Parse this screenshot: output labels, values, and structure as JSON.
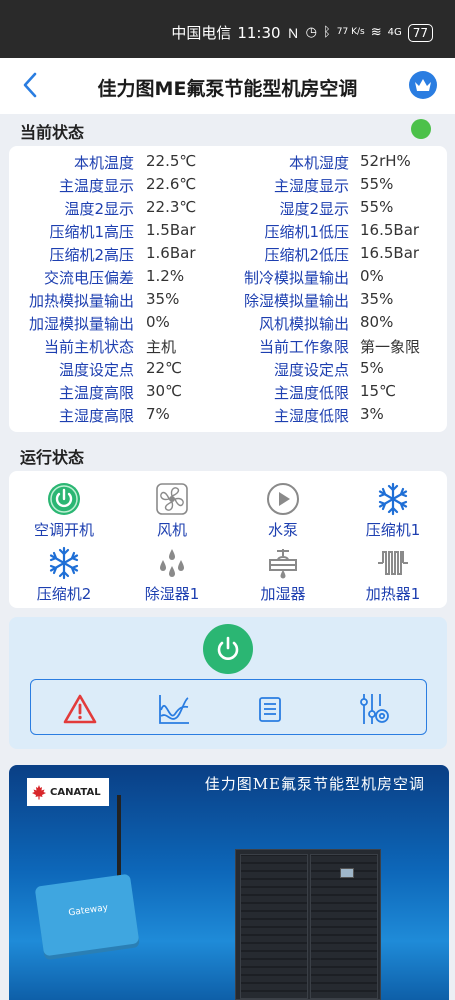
{
  "status_bar": {
    "carrier": "中国电信",
    "time": "11:30",
    "net_speed": "77 K/s",
    "signal": "4G",
    "battery": "77"
  },
  "header": {
    "title": "佳力图ME氟泵节能型机房空调"
  },
  "current_status": {
    "section_title": "当前状态",
    "indicator_color": "#4cc14a",
    "rows": [
      {
        "l1": "本机温度",
        "v1": "22.5℃",
        "l2": "本机湿度",
        "v2": "52rH%"
      },
      {
        "l1": "主温度显示",
        "v1": "22.6℃",
        "l2": "主湿度显示",
        "v2": "55%"
      },
      {
        "l1": "温度2显示",
        "v1": "22.3℃",
        "l2": "湿度2显示",
        "v2": "55%"
      },
      {
        "l1": "压缩机1高压",
        "v1": "1.5Bar",
        "l2": "压缩机1低压",
        "v2": "16.5Bar"
      },
      {
        "l1": "压缩机2高压",
        "v1": "1.6Bar",
        "l2": "压缩机2低压",
        "v2": "16.5Bar"
      },
      {
        "l1": "交流电压偏差",
        "v1": "1.2%",
        "l2": "制冷模拟量输出",
        "v2": "0%"
      },
      {
        "l1": "加热模拟量输出",
        "v1": "35%",
        "l2": "除湿模拟量输出",
        "v2": "35%"
      },
      {
        "l1": "加湿模拟量输出",
        "v1": "0%",
        "l2": "风机模拟输出",
        "v2": "80%"
      },
      {
        "l1": "当前主机状态",
        "v1": "主机",
        "l2": "当前工作象限",
        "v2": "第一象限"
      },
      {
        "l1": "温度设定点",
        "v1": "22℃",
        "l2": "湿度设定点",
        "v2": "5%"
      },
      {
        "l1": "主温度高限",
        "v1": "30℃",
        "l2": "主温度低限",
        "v2": "15℃"
      },
      {
        "l1": "主湿度高限",
        "v1": "7%",
        "l2": "主湿度低限",
        "v2": "3%"
      }
    ]
  },
  "run_status": {
    "section_title": "运行状态",
    "items": [
      {
        "label": "空调开机",
        "icon": "power-on-icon"
      },
      {
        "label": "风机",
        "icon": "fan-icon"
      },
      {
        "label": "水泵",
        "icon": "pump-icon"
      },
      {
        "label": "压缩机1",
        "icon": "snowflake-icon"
      },
      {
        "label": "压缩机2",
        "icon": "snowflake-icon"
      },
      {
        "label": "除湿器1",
        "icon": "droplets-icon"
      },
      {
        "label": "加湿器",
        "icon": "humidifier-icon"
      },
      {
        "label": "加热器1",
        "icon": "heater-icon"
      }
    ]
  },
  "controls": {
    "power_color": "#2bb673",
    "buttons": [
      "alarm-icon",
      "chart-icon",
      "list-icon",
      "settings-sliders-icon"
    ]
  },
  "banner": {
    "title": "佳力图ME氟泵节能型机房空调",
    "logo_text": "CANATAL",
    "gateway_label": "Gateway"
  },
  "colors": {
    "accent": "#2a7de1",
    "label": "#1d3fb0",
    "on_green": "#2bb673"
  }
}
